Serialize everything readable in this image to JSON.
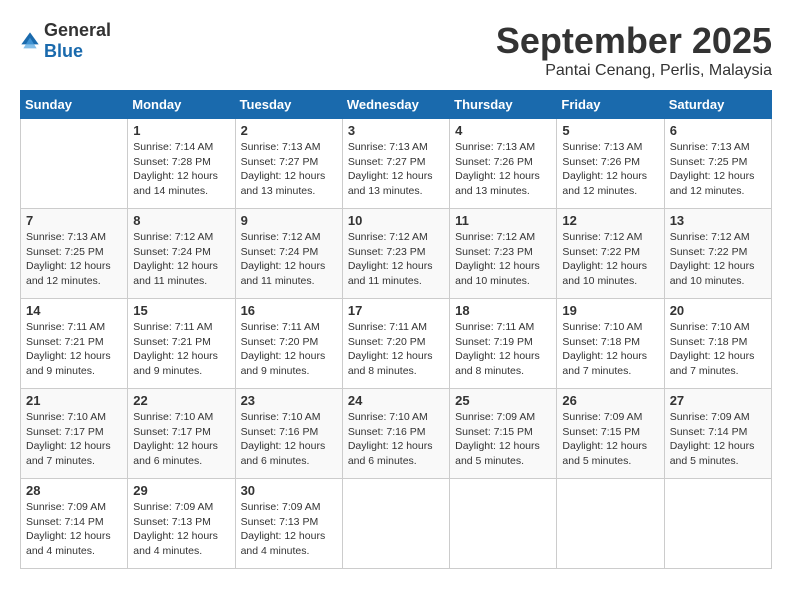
{
  "logo": {
    "text_general": "General",
    "text_blue": "Blue"
  },
  "title": "September 2025",
  "subtitle": "Pantai Cenang, Perlis, Malaysia",
  "days_of_week": [
    "Sunday",
    "Monday",
    "Tuesday",
    "Wednesday",
    "Thursday",
    "Friday",
    "Saturday"
  ],
  "weeks": [
    [
      {
        "day": "",
        "info": ""
      },
      {
        "day": "1",
        "info": "Sunrise: 7:14 AM\nSunset: 7:28 PM\nDaylight: 12 hours\nand 14 minutes."
      },
      {
        "day": "2",
        "info": "Sunrise: 7:13 AM\nSunset: 7:27 PM\nDaylight: 12 hours\nand 13 minutes."
      },
      {
        "day": "3",
        "info": "Sunrise: 7:13 AM\nSunset: 7:27 PM\nDaylight: 12 hours\nand 13 minutes."
      },
      {
        "day": "4",
        "info": "Sunrise: 7:13 AM\nSunset: 7:26 PM\nDaylight: 12 hours\nand 13 minutes."
      },
      {
        "day": "5",
        "info": "Sunrise: 7:13 AM\nSunset: 7:26 PM\nDaylight: 12 hours\nand 12 minutes."
      },
      {
        "day": "6",
        "info": "Sunrise: 7:13 AM\nSunset: 7:25 PM\nDaylight: 12 hours\nand 12 minutes."
      }
    ],
    [
      {
        "day": "7",
        "info": "Sunrise: 7:13 AM\nSunset: 7:25 PM\nDaylight: 12 hours\nand 12 minutes."
      },
      {
        "day": "8",
        "info": "Sunrise: 7:12 AM\nSunset: 7:24 PM\nDaylight: 12 hours\nand 11 minutes."
      },
      {
        "day": "9",
        "info": "Sunrise: 7:12 AM\nSunset: 7:24 PM\nDaylight: 12 hours\nand 11 minutes."
      },
      {
        "day": "10",
        "info": "Sunrise: 7:12 AM\nSunset: 7:23 PM\nDaylight: 12 hours\nand 11 minutes."
      },
      {
        "day": "11",
        "info": "Sunrise: 7:12 AM\nSunset: 7:23 PM\nDaylight: 12 hours\nand 10 minutes."
      },
      {
        "day": "12",
        "info": "Sunrise: 7:12 AM\nSunset: 7:22 PM\nDaylight: 12 hours\nand 10 minutes."
      },
      {
        "day": "13",
        "info": "Sunrise: 7:12 AM\nSunset: 7:22 PM\nDaylight: 12 hours\nand 10 minutes."
      }
    ],
    [
      {
        "day": "14",
        "info": "Sunrise: 7:11 AM\nSunset: 7:21 PM\nDaylight: 12 hours\nand 9 minutes."
      },
      {
        "day": "15",
        "info": "Sunrise: 7:11 AM\nSunset: 7:21 PM\nDaylight: 12 hours\nand 9 minutes."
      },
      {
        "day": "16",
        "info": "Sunrise: 7:11 AM\nSunset: 7:20 PM\nDaylight: 12 hours\nand 9 minutes."
      },
      {
        "day": "17",
        "info": "Sunrise: 7:11 AM\nSunset: 7:20 PM\nDaylight: 12 hours\nand 8 minutes."
      },
      {
        "day": "18",
        "info": "Sunrise: 7:11 AM\nSunset: 7:19 PM\nDaylight: 12 hours\nand 8 minutes."
      },
      {
        "day": "19",
        "info": "Sunrise: 7:10 AM\nSunset: 7:18 PM\nDaylight: 12 hours\nand 7 minutes."
      },
      {
        "day": "20",
        "info": "Sunrise: 7:10 AM\nSunset: 7:18 PM\nDaylight: 12 hours\nand 7 minutes."
      }
    ],
    [
      {
        "day": "21",
        "info": "Sunrise: 7:10 AM\nSunset: 7:17 PM\nDaylight: 12 hours\nand 7 minutes."
      },
      {
        "day": "22",
        "info": "Sunrise: 7:10 AM\nSunset: 7:17 PM\nDaylight: 12 hours\nand 6 minutes."
      },
      {
        "day": "23",
        "info": "Sunrise: 7:10 AM\nSunset: 7:16 PM\nDaylight: 12 hours\nand 6 minutes."
      },
      {
        "day": "24",
        "info": "Sunrise: 7:10 AM\nSunset: 7:16 PM\nDaylight: 12 hours\nand 6 minutes."
      },
      {
        "day": "25",
        "info": "Sunrise: 7:09 AM\nSunset: 7:15 PM\nDaylight: 12 hours\nand 5 minutes."
      },
      {
        "day": "26",
        "info": "Sunrise: 7:09 AM\nSunset: 7:15 PM\nDaylight: 12 hours\nand 5 minutes."
      },
      {
        "day": "27",
        "info": "Sunrise: 7:09 AM\nSunset: 7:14 PM\nDaylight: 12 hours\nand 5 minutes."
      }
    ],
    [
      {
        "day": "28",
        "info": "Sunrise: 7:09 AM\nSunset: 7:14 PM\nDaylight: 12 hours\nand 4 minutes."
      },
      {
        "day": "29",
        "info": "Sunrise: 7:09 AM\nSunset: 7:13 PM\nDaylight: 12 hours\nand 4 minutes."
      },
      {
        "day": "30",
        "info": "Sunrise: 7:09 AM\nSunset: 7:13 PM\nDaylight: 12 hours\nand 4 minutes."
      },
      {
        "day": "",
        "info": ""
      },
      {
        "day": "",
        "info": ""
      },
      {
        "day": "",
        "info": ""
      },
      {
        "day": "",
        "info": ""
      }
    ]
  ]
}
